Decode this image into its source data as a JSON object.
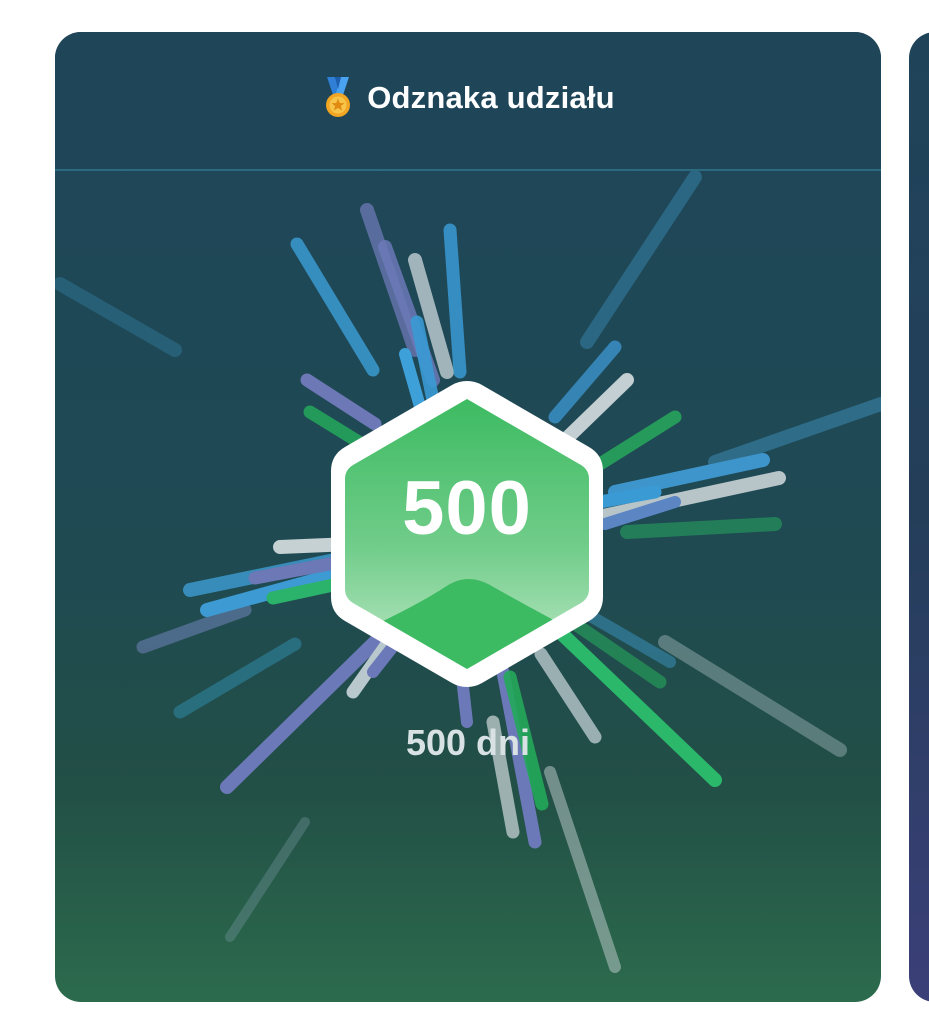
{
  "header": {
    "icon": "medal-icon",
    "title": "Odznaka udziału"
  },
  "badge": {
    "number": "500",
    "color": "#3dbb62"
  },
  "caption": "500 dni",
  "colors": {
    "card_top": "#1f4559",
    "card_bottom": "#2c6b4d",
    "next_card": "#3b3f78"
  }
}
